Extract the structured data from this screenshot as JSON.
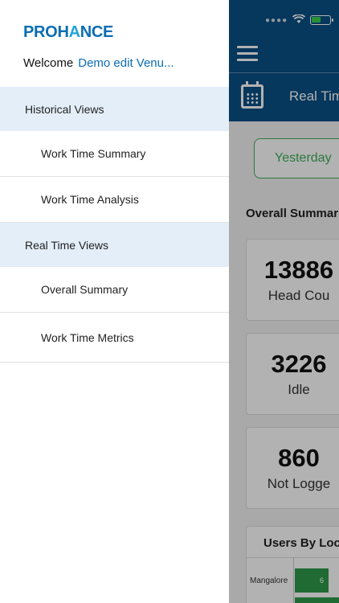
{
  "app": {
    "header_title": "Real Tim",
    "filter_button": "Yesterday",
    "section_title": "Overall Summar",
    "stats": [
      {
        "value": "13886",
        "label": "Head Cou"
      },
      {
        "value": "3226",
        "label": "Idle"
      },
      {
        "value": "860",
        "label": "Not Logge"
      }
    ],
    "locations_card": {
      "title": "Users By Loca",
      "rows": [
        {
          "label": "Mangalore",
          "value": "6"
        }
      ]
    },
    "colors": {
      "header": "#0a4f86",
      "accent": "#3fae5a"
    },
    "battery_level": 0.55
  },
  "drawer": {
    "logo": {
      "part1": "PROH",
      "part2": "A",
      "part3": "NCE"
    },
    "welcome_label": "Welcome",
    "user_name": "Demo edit Venu...",
    "menu": [
      {
        "section": "Historical Views",
        "items": [
          "Work Time Summary",
          "Work Time Analysis"
        ]
      },
      {
        "section": "Real Time Views",
        "items": [
          "Overall Summary",
          "Work Time Metrics"
        ]
      }
    ]
  }
}
